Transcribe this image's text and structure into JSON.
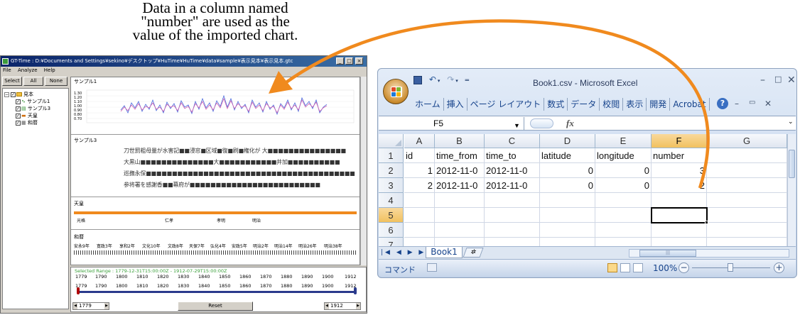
{
  "annotation": {
    "lines": [
      "Data in a column named",
      "\"number\" are used as the",
      "value of the imported chart."
    ]
  },
  "colors": {
    "arrow": "#f08a1e",
    "gt_title": "#0a246a",
    "excel_blue": "#15428b",
    "selected_col": "#f1c15f"
  },
  "gt_window": {
    "title": "GT-Time : D:¥Documents and Settings¥sekino¥デスクトップ¥HuTime¥HuTime¥data¥sample¥表示見本¥表示見本.gtc",
    "menu": [
      "File",
      "Analyze",
      "Help"
    ],
    "toolbar": {
      "select": "Select",
      "all": "All",
      "none": "None"
    },
    "tree": {
      "root": "見本",
      "items": [
        "サンプル1",
        "サンプル3",
        "天皇",
        "和暦"
      ]
    },
    "panels": {
      "sample1": "サンプル1",
      "sample3": "サンプル3",
      "tenno": "天皇",
      "wareki": "和暦"
    },
    "chart_ticks": [
      "1.30",
      "1.20",
      "1.10",
      "1.00",
      "0.90",
      "0.80",
      "0.70"
    ],
    "doc_lines": [
      "刀世罰粗母量が水害記■■浸窓■区域■復■刷■権化が 大■■■■■■■■■■■■■■■",
      "大黒山■■■■■■■■■■■■■■大■■■■■■■■■■■井加■■■■■■■■■■",
      "巡撫永保■■■■■■■■■■■■■■■■■■■■■■■■■■■■■■■■■■■■■■■■",
      "参将署を感謝香■■幕府が■■■■■■■■■■■■■■■■■■■■■■■■■"
    ],
    "eras": [
      "光格",
      "仁孝",
      "孝明",
      "明治"
    ],
    "wareki_eras": [
      "安永9年",
      "寛政3年",
      "享和2年",
      "文化10年",
      "文政8年",
      "天保7年",
      "弘化4年",
      "安政5年",
      "明治2年",
      "明治14年",
      "明治26年",
      "明治38年"
    ],
    "range_text": "Selected Range : 1779-12-31T15:00:00Z - 1912-07-29T15:00:00Z",
    "years": [
      "1779",
      "1790",
      "1800",
      "1810",
      "1820",
      "1830",
      "1840",
      "1850",
      "1860",
      "1870",
      "1880",
      "1890",
      "1900",
      "1912"
    ],
    "years2": [
      "1779",
      "1790",
      "1800",
      "1810",
      "1820",
      "1830",
      "1840",
      "1850",
      "1860",
      "1870",
      "1880",
      "1890",
      "1900",
      "1912"
    ],
    "spin_left": "1779",
    "spin_right": "1912",
    "reset": "Reset"
  },
  "excel": {
    "title": "Book1.csv - Microsoft Excel",
    "tabs": [
      "ホーム",
      "挿入",
      "ページ レイアウト",
      "数式",
      "データ",
      "校閲",
      "表示",
      "開発",
      "Acrobat"
    ],
    "name_box": "F5",
    "fx": "fx",
    "columns": [
      "A",
      "B",
      "C",
      "D",
      "E",
      "F",
      "G"
    ],
    "rows": [
      "1",
      "2",
      "3",
      "4",
      "5",
      "6",
      "7"
    ],
    "table": [
      [
        "id",
        "time_from",
        "time_to",
        "latitude",
        "longitude",
        "number",
        ""
      ],
      [
        "1",
        "2012-11-0",
        "2012-11-0",
        "0",
        "0",
        "3",
        ""
      ],
      [
        "2",
        "2012-11-0",
        "2012-11-0",
        "0",
        "0",
        "2",
        ""
      ]
    ],
    "sheet_tab": "Book1",
    "status_mode": "コマンド",
    "zoom": "100%"
  }
}
